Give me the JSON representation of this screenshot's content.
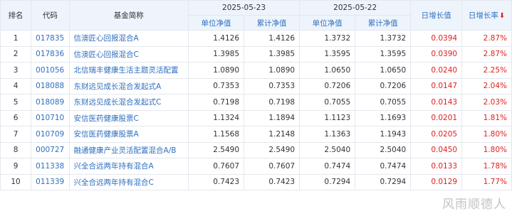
{
  "headers": {
    "rank": "排名",
    "code": "代码",
    "name": "基金简称",
    "date1": "2025-05-23",
    "date2": "2025-05-22",
    "unit_nav": "单位净值",
    "acc_nav": "累计净值",
    "daily_growth_value": "日增长值",
    "daily_growth_rate": "日增长率",
    "sort_arrow": "⬇"
  },
  "rows": [
    {
      "rank": "1",
      "code": "017835",
      "name": "信澳匠心回报混合A",
      "nav1": "1.4126",
      "acc1": "1.4126",
      "nav2": "1.3732",
      "acc2": "1.3732",
      "growth": "0.0394",
      "rate": "2.87%"
    },
    {
      "rank": "2",
      "code": "017836",
      "name": "信澳匠心回报混合C",
      "nav1": "1.3985",
      "acc1": "1.3985",
      "nav2": "1.3595",
      "acc2": "1.3595",
      "growth": "0.0390",
      "rate": "2.87%"
    },
    {
      "rank": "3",
      "code": "001056",
      "name": "北信瑞丰健康生活主题灵活配置",
      "nav1": "1.0890",
      "acc1": "1.0890",
      "nav2": "1.0650",
      "acc2": "1.0650",
      "growth": "0.0240",
      "rate": "2.25%"
    },
    {
      "rank": "4",
      "code": "018088",
      "name": "东财远见成长混合发起式A",
      "nav1": "0.7353",
      "acc1": "0.7353",
      "nav2": "0.7206",
      "acc2": "0.7206",
      "growth": "0.0147",
      "rate": "2.04%"
    },
    {
      "rank": "5",
      "code": "018089",
      "name": "东财远见成长混合发起式C",
      "nav1": "0.7198",
      "acc1": "0.7198",
      "nav2": "0.7055",
      "acc2": "0.7055",
      "growth": "0.0143",
      "rate": "2.03%"
    },
    {
      "rank": "6",
      "code": "010710",
      "name": "安信医药健康股票C",
      "nav1": "1.1324",
      "acc1": "1.1894",
      "nav2": "1.1123",
      "acc2": "1.1693",
      "growth": "0.0201",
      "rate": "1.81%"
    },
    {
      "rank": "7",
      "code": "010709",
      "name": "安信医药健康股票A",
      "nav1": "1.1568",
      "acc1": "1.2148",
      "nav2": "1.1363",
      "acc2": "1.1943",
      "growth": "0.0205",
      "rate": "1.80%"
    },
    {
      "rank": "8",
      "code": "000727",
      "name": "融通健康产业灵活配置混合A/B",
      "nav1": "2.5490",
      "acc1": "2.5490",
      "nav2": "2.5040",
      "acc2": "2.5040",
      "growth": "0.0450",
      "rate": "1.80%"
    },
    {
      "rank": "9",
      "code": "011338",
      "name": "兴全合远两年持有混合A",
      "nav1": "0.7607",
      "acc1": "0.7607",
      "nav2": "0.7474",
      "acc2": "0.7474",
      "growth": "0.0133",
      "rate": "1.78%"
    },
    {
      "rank": "10",
      "code": "011339",
      "name": "兴全合远两年持有混合C",
      "nav1": "0.7423",
      "acc1": "0.7423",
      "nav2": "0.7294",
      "acc2": "0.7294",
      "growth": "0.0129",
      "rate": "1.77%"
    }
  ],
  "watermark": "风雨顺德人"
}
